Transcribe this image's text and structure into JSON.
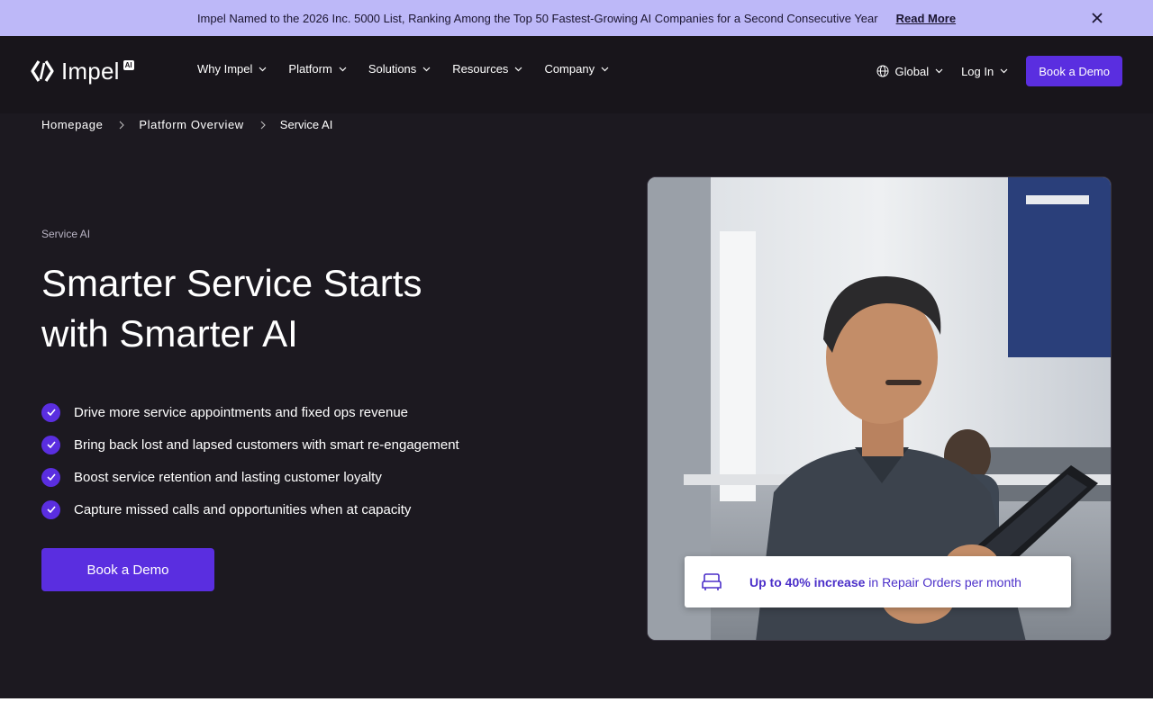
{
  "announcement": {
    "text": "Impel Named to the 2026 Inc. 5000 List, Ranking Among the Top 50 Fastest-Growing AI Companies for a Second Consecutive Year",
    "link": "Read More",
    "close_icon": "close-icon"
  },
  "brand": {
    "name": "Impel",
    "badge": "AI"
  },
  "nav": {
    "items": [
      {
        "label": "Why Impel"
      },
      {
        "label": "Platform"
      },
      {
        "label": "Solutions"
      },
      {
        "label": "Resources"
      },
      {
        "label": "Company"
      }
    ],
    "region": "Global",
    "login": "Log In",
    "demo": "Book a Demo"
  },
  "breadcrumb": [
    "Homepage",
    "Platform Overview",
    "Service AI"
  ],
  "hero": {
    "eyebrow": "Service AI",
    "title_line1": "Smarter Service Starts",
    "title_line2": "with Smarter AI",
    "bullets": [
      "Drive more service appointments and fixed ops revenue",
      "Bring back lost and lapsed customers with smart re-engagement",
      "Boost service retention and lasting customer loyalty",
      "Capture missed calls and opportunities when at capacity"
    ],
    "cta": "Book a Demo"
  },
  "stat": {
    "strong": "Up to 40% increase",
    "rest": " in Repair Orders per month",
    "icon": "car-seat-icon"
  },
  "colors": {
    "background": "#1c1920",
    "accent": "#5a2ee0",
    "banner": "#bdb8f8"
  }
}
